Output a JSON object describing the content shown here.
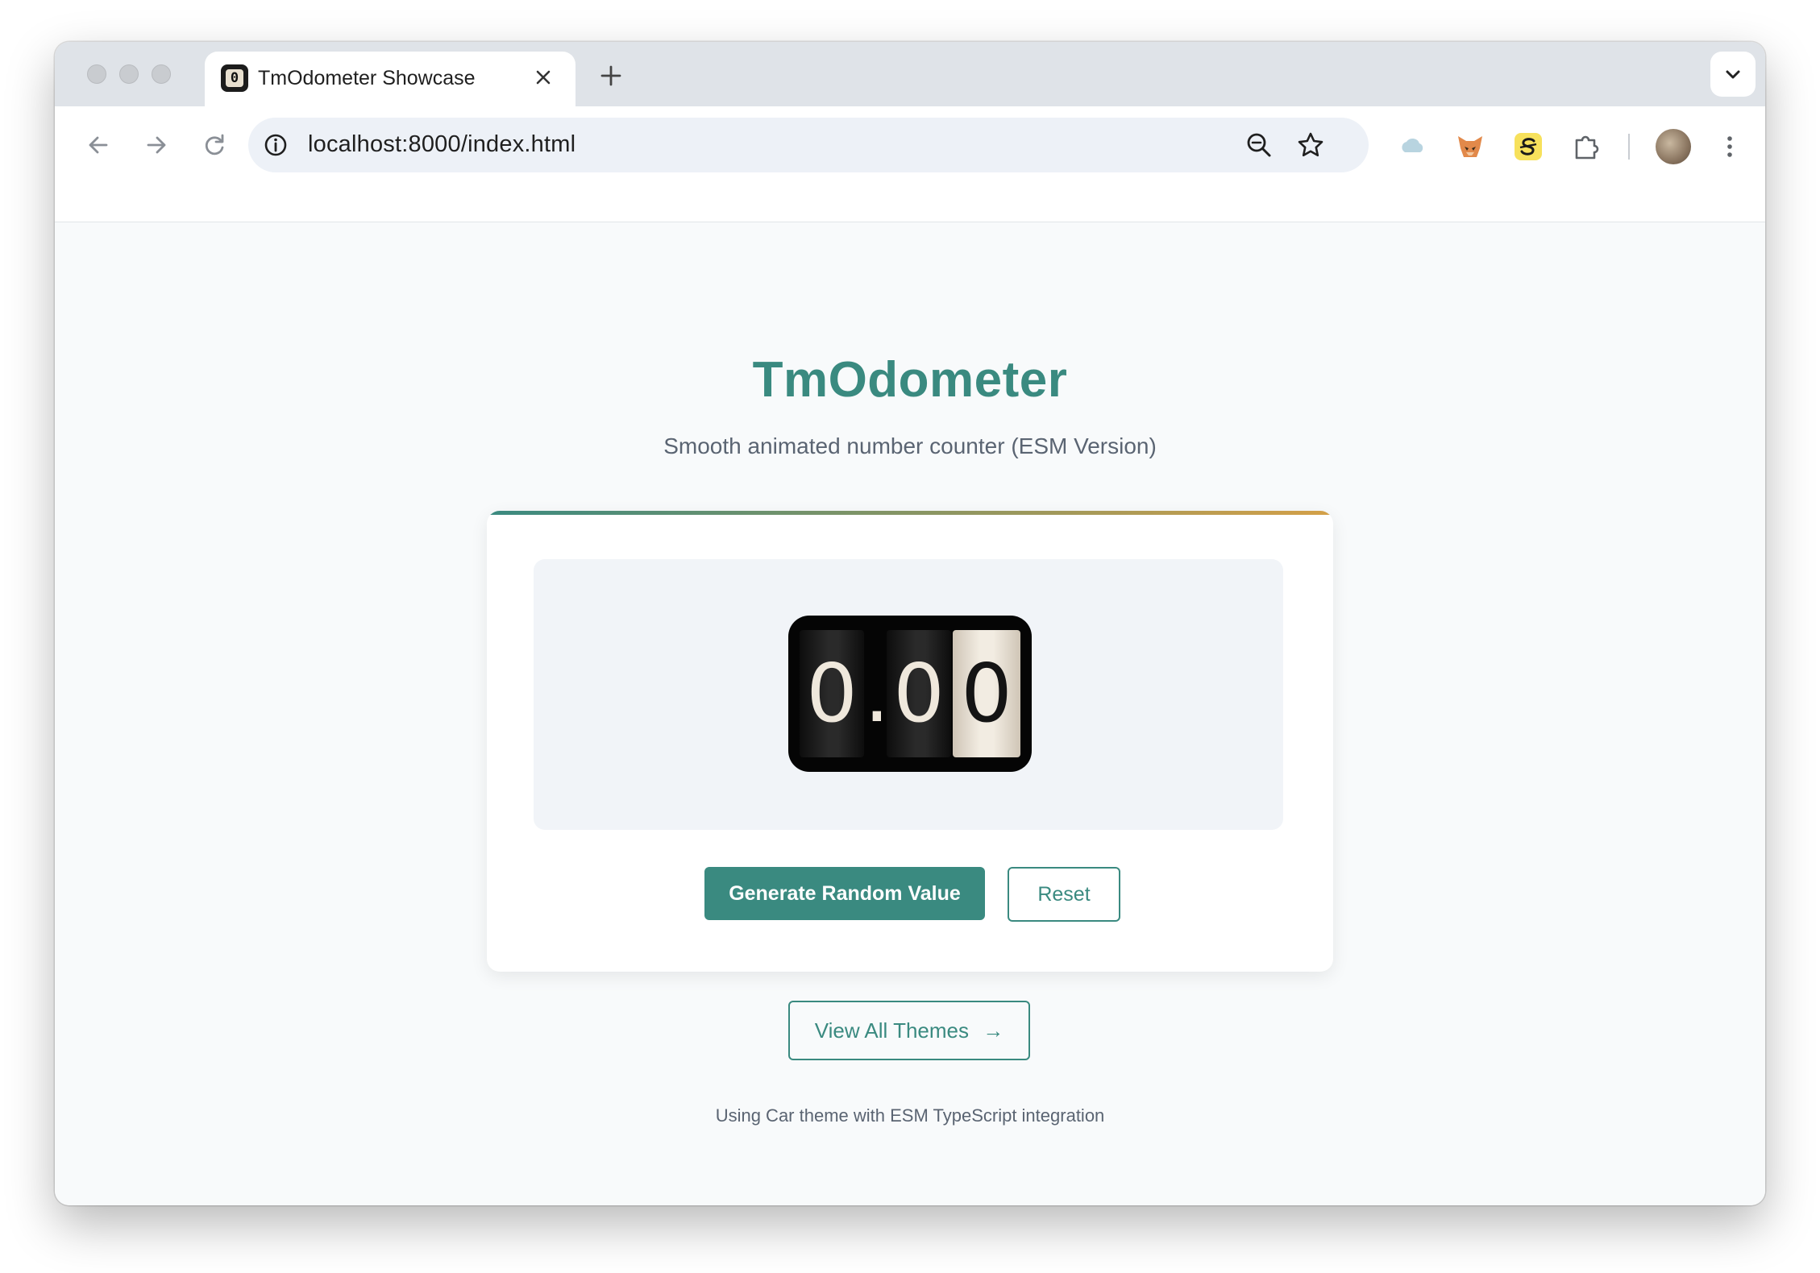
{
  "browser": {
    "tab_title": "TmOdometer Showcase",
    "tab_favicon_char": "0",
    "url": "localhost:8000/index.html",
    "icons": {
      "back": "arrow-left-icon",
      "forward": "arrow-right-icon",
      "reload": "reload-icon",
      "site_info": "info-icon",
      "zoom": "zoom-out-icon",
      "bookmark": "star-icon",
      "extensions": [
        "cloud-icon",
        "fox-icon",
        "s-logo-icon",
        "puzzle-icon"
      ],
      "profile": "avatar",
      "menu": "kebab-menu-icon"
    }
  },
  "page": {
    "title": "TmOdometer",
    "subtitle": "Smooth animated number counter (ESM Version)",
    "odometer": {
      "digits": [
        "0",
        ".",
        "0",
        "0"
      ]
    },
    "buttons": {
      "generate": "Generate Random Value",
      "reset": "Reset"
    },
    "themes_link": "View All Themes",
    "themes_arrow": "→",
    "footer": "Using Car theme with ESM TypeScript integration"
  },
  "colors": {
    "accent": "#3a8a80",
    "gradient_end": "#d4a048"
  }
}
